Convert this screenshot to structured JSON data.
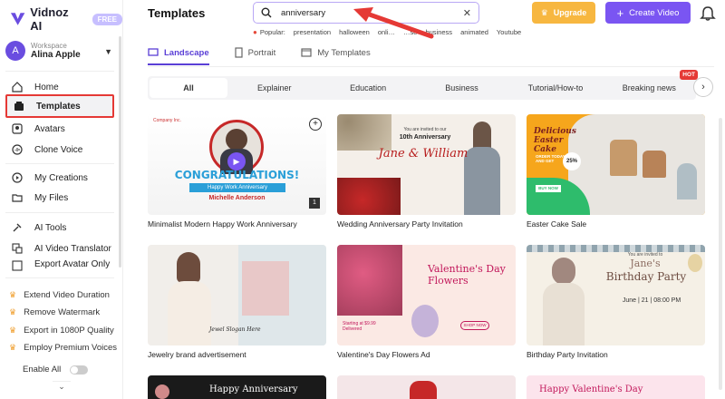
{
  "app": {
    "logo_text": "Vidnoz AI",
    "badge": "FREE"
  },
  "workspace": {
    "label": "Workspace",
    "name": "Alina Apple",
    "avatar_letter": "A"
  },
  "sidebar": {
    "items": [
      {
        "label": "Home",
        "icon": "home-icon"
      },
      {
        "label": "Templates",
        "icon": "templates-icon",
        "active": true
      },
      {
        "label": "Avatars",
        "icon": "avatar-icon"
      },
      {
        "label": "Clone Voice",
        "icon": "voice-icon"
      },
      {
        "label": "My Creations",
        "icon": "play-icon"
      },
      {
        "label": "My Files",
        "icon": "folder-icon"
      },
      {
        "label": "AI Tools",
        "icon": "tools-icon"
      },
      {
        "label": "AI Video Translator",
        "icon": "translate-icon"
      },
      {
        "label": "Export Avatar Only",
        "icon": "export-icon"
      }
    ],
    "promos": [
      "Extend Video Duration",
      "Remove Watermark",
      "Export in 1080P Quality",
      "Employ Premium Voices"
    ],
    "enable_all": "Enable All"
  },
  "header": {
    "title": "Templates",
    "search_value": "anniversary",
    "popular_label": "Popular:",
    "popular_tags": [
      "presentation",
      "halloween",
      "onli…",
      "…se",
      "business",
      "animated",
      "Youtube"
    ],
    "upgrade_label": "Upgrade",
    "create_label": "Create Video"
  },
  "tabs": [
    "Landscape",
    "Portrait",
    "My Templates"
  ],
  "categories": [
    "All",
    "Explainer",
    "Education",
    "Business",
    "Tutorial/How-to",
    "Breaking news"
  ],
  "hot_label": "HOT",
  "cards": [
    {
      "title": "Minimalist Modern Happy Work Anniversary",
      "line1": "CONGRATULATIONS!",
      "line2": "Happy Work Anniversary",
      "line3": "Michelle Anderson",
      "badge": "1",
      "company": "Company Inc."
    },
    {
      "title": "Wedding Anniversary Party Invitation",
      "line0": "You are invited to our",
      "line1": "10th Anniversary",
      "line2": "Jane & William"
    },
    {
      "title": "Easter Cake Sale",
      "line1": "Delicious Easter Cake",
      "line2": "ORDER TODAY AND GET",
      "line3": "25%",
      "line4": "BUY NOW"
    },
    {
      "title": "Jewelry brand advertisement",
      "line1": "Jewel Slogan Here"
    },
    {
      "title": "Valentine's Day Flowers Ad",
      "line1": "Valentine's Day Flowers",
      "line2": "SHOP NOW",
      "line3": "Starting at $9.99 Delivered"
    },
    {
      "title": "Birthday Party Invitation",
      "line0": "You are invited to",
      "line1": "Jane's",
      "line2": "Birthday Party",
      "line3": "June | 21 | 08:00 PM"
    },
    {
      "title": "",
      "line1": "Happy Anniversary"
    },
    {
      "title": "",
      "line1": ""
    },
    {
      "title": "",
      "line1": "Happy Valentine's Day"
    }
  ]
}
